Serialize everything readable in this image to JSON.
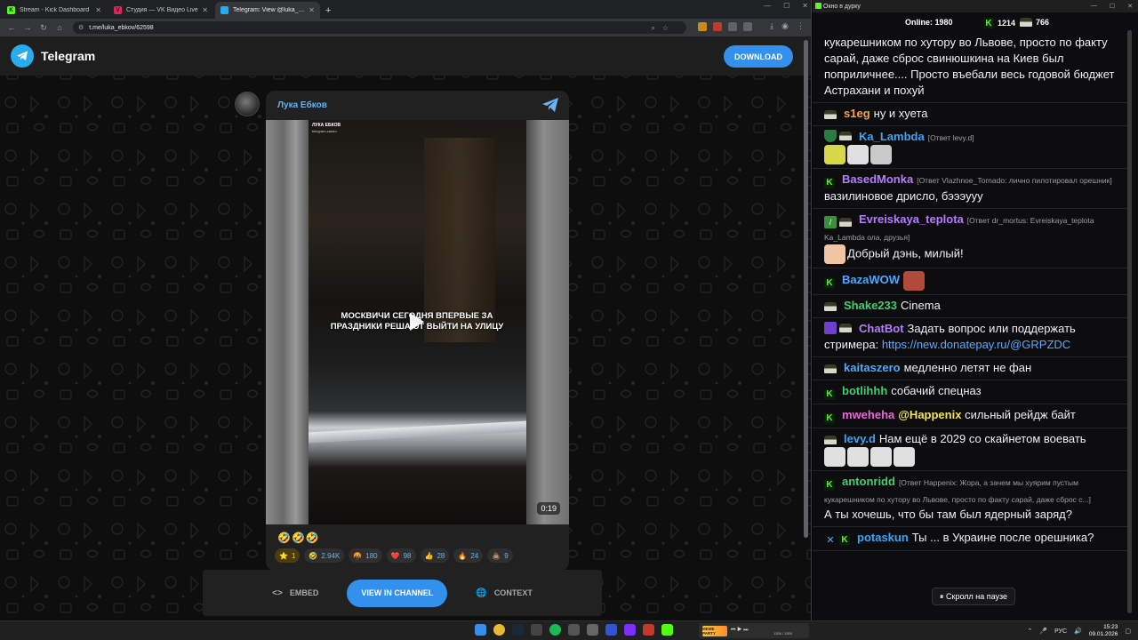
{
  "browser": {
    "tabs": [
      {
        "label": "Stream - Kick Dashboard",
        "fav_color": "#53fc18",
        "fav_glyph": "K"
      },
      {
        "label": "Студия — VK Видео Live",
        "fav_color": "#e0245e",
        "fav_glyph": "V"
      },
      {
        "label": "Telegram: View @luka_ebkov",
        "fav_color": "#2aabee",
        "fav_glyph": ""
      }
    ],
    "active_tab": 2,
    "url": "t.me/luka_ebkov/62598"
  },
  "telegram": {
    "brand": "Telegram",
    "download_label": "DOWNLOAD",
    "channel_name": "Лука Ебков",
    "video": {
      "brand_line1": "ЛУКА ЕБКОВ",
      "brand_line2": "telegram-канал",
      "caption": "МОСКВИЧИ СЕГОДНЯ ВПЕРВЫЕ ЗА ПРАЗДНИКИ РЕШАЮТ ВЫЙТИ НА УЛИЦУ",
      "duration": "0:19"
    },
    "text_emojis": "🤣🤣🤣",
    "reactions": [
      {
        "emoji": "⭐",
        "count": "1",
        "kind": "star"
      },
      {
        "emoji": "🤣",
        "count": "2.94K",
        "kind": "normal"
      },
      {
        "emoji": "🤬",
        "count": "180",
        "kind": "normal"
      },
      {
        "emoji": "❤️",
        "count": "98",
        "kind": "normal"
      },
      {
        "emoji": "👍",
        "count": "28",
        "kind": "normal"
      },
      {
        "emoji": "🔥",
        "count": "24",
        "kind": "normal"
      },
      {
        "emoji": "💩",
        "count": "9",
        "kind": "normal"
      }
    ],
    "bottom": {
      "embed_label": "EMBED",
      "view_label": "VIEW IN CHANNEL",
      "context_label": "CONTEXT"
    }
  },
  "chat": {
    "window_title": "Окно в дурку",
    "online_label": "Online:",
    "online_count": "1980",
    "kick_count": "1214",
    "other_count": "766",
    "paused_label": "⏸ Скролл на паузе",
    "messages": [
      {
        "user": "",
        "color": "#efeff1",
        "badges": [],
        "reply": "",
        "text": "кукарешником по хутору во Львове, просто по факту сарай, даже сброс свинюшкина на Киев был поприличнее.... Просто въебали весь годовой бюджет Астрахани и похуй",
        "emotes": []
      },
      {
        "user": "s1eg",
        "color": "#f4a340",
        "badges": [
          "hat"
        ],
        "reply": "",
        "text": "ну и хуета",
        "emotes": []
      },
      {
        "user": "Ka_Lambda",
        "color": "#3ba4f7",
        "badges": [
          "shield",
          "hat"
        ],
        "reply": "[Ответ levy.d]",
        "text": "",
        "emotes": [
          "#d6d84a",
          "#e0e0e0",
          "#c9c9c9"
        ]
      },
      {
        "user": "BasedMonka",
        "color": "#b67bff",
        "badges": [
          "kick"
        ],
        "reply": "[Ответ Vlazhnoe_Tornado: лично пилотировал орешник]",
        "text": "вазилиновое дрисло, бэээууу",
        "emotes": []
      },
      {
        "user": "Evreiskaya_teplota",
        "color": "#b67bff",
        "badges": [
          "sword",
          "hat"
        ],
        "reply": "[Ответ dr_mortus: Evreiskaya_teplota Ka_Lambda ола, друзья]",
        "text": "Добрый дэнь, милый!",
        "emotes": [
          "#f1c4a4"
        ]
      },
      {
        "user": "BazaWOW",
        "color": "#4ea8ff",
        "badges": [
          "kick"
        ],
        "reply": "",
        "text": "",
        "emotes": [
          "#b04a3a"
        ]
      },
      {
        "user": "Shake233",
        "color": "#3fcf70",
        "badges": [
          "hat"
        ],
        "reply": "",
        "text": "Cinema",
        "emotes": []
      },
      {
        "user": "ChatBot",
        "color": "#b67bff",
        "badges": [
          "bot",
          "hat"
        ],
        "reply": "",
        "text": "Задать вопрос или поддержать стримера:",
        "link": "https://new.donatepay.ru/@GRPZDC",
        "emotes": []
      },
      {
        "user": "kaitaszero",
        "color": "#4ea8ff",
        "badges": [
          "hat"
        ],
        "reply": "",
        "text": "медленно летят не фан",
        "emotes": []
      },
      {
        "user": "botlihhh",
        "color": "#3fcf70",
        "badges": [
          "kick"
        ],
        "reply": "",
        "text": "собачий спецназ",
        "emotes": []
      },
      {
        "user": "mweheha",
        "color": "#e86ad8",
        "badges": [
          "kick"
        ],
        "reply": "",
        "mention": "@Happenix",
        "text": "сильный рейдж байт",
        "emotes": []
      },
      {
        "user": "levy.d",
        "color": "#3ba4f7",
        "badges": [
          "hat"
        ],
        "reply": "",
        "text": "Нам ещё в 2029 со скайнетом воевать",
        "emotes": [
          "#e0e0e0",
          "#e0e0e0",
          "#e0e0e0",
          "#e0e0e0"
        ]
      },
      {
        "user": "antonridd",
        "color": "#3fcf70",
        "badges": [
          "kick"
        ],
        "reply": "[Ответ Happenix: Жора, а зачем мы хуярим пустым кукарешником по хутору во Львове, просто по факту сарай, даже сброс с...]",
        "text": "А ты хочешь, что бы там был ядерный заряд?",
        "emotes": []
      },
      {
        "user": "potaskun",
        "color": "#3ba4f7",
        "badges": [
          "bluesword",
          "kick"
        ],
        "reply": "",
        "text": "Ты ... в Украине после орешника?",
        "emotes": []
      }
    ]
  },
  "taskbar": {
    "media_title": "MEME PARTY",
    "media_sub": "⏮ ▶ ⏭",
    "media_time": "1306 / 1500",
    "lang": "РУС",
    "time": "15:23",
    "date": "09.01.2026"
  }
}
